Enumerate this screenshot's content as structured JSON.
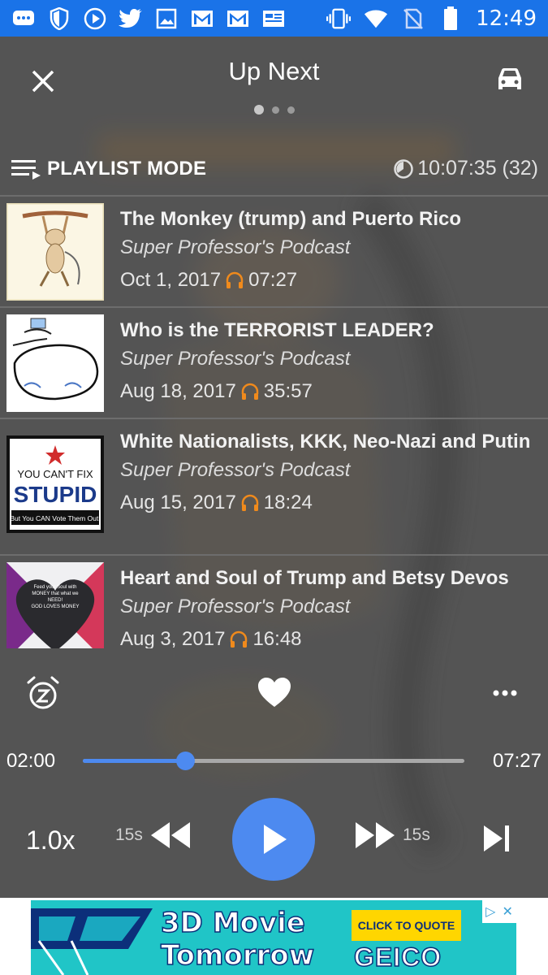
{
  "status_bar": {
    "time": "12:49",
    "icons": [
      "chat-icon",
      "shield-icon",
      "play-circle-icon",
      "twitter-icon",
      "image-icon",
      "gmail-icon",
      "gmail-icon",
      "news-icon",
      "vibrate-icon",
      "wifi-icon",
      "no-sim-icon",
      "battery-icon"
    ]
  },
  "header": {
    "title": "Up Next",
    "page_dots": 3,
    "active_dot": 0
  },
  "mode_row": {
    "mode_label": "PLAYLIST MODE",
    "total_duration": "10:07:35 (32)"
  },
  "episodes": [
    {
      "title": "The Monkey (trump) and Puerto Rico",
      "show": "Super Professor's Podcast",
      "date": "Oct 1, 2017",
      "duration": "07:27"
    },
    {
      "title": "Who is the TERRORIST LEADER?",
      "show": "Super Professor's Podcast",
      "date": "Aug 18, 2017",
      "duration": "35:57"
    },
    {
      "title": "White Nationalists, KKK, Neo-Nazi and Putin",
      "show": "Super Professor's Podcast",
      "date": "Aug 15, 2017",
      "duration": "18:24",
      "thumb_text": {
        "line1": "YOU CAN'T FIX",
        "line2": "STUPID",
        "line3": "But You CAN Vote Them Out!"
      }
    },
    {
      "title": "Heart and Soul of Trump and Betsy Devos",
      "show": "Super Professor's Podcast",
      "date": "Aug 3, 2017",
      "duration": "16:48",
      "thumb_text": {
        "line1": "Feed your Soul with",
        "line2": "MONEY that what we",
        "line3": "NEED!",
        "line4": "GOD LOVES MONEY"
      }
    }
  ],
  "player": {
    "current_time": "02:00",
    "total_time": "07:27",
    "progress": 0.268,
    "speed": "1.0x",
    "rewind_label": "15s",
    "forward_label": "15s"
  },
  "ad": {
    "headline_line1": "3D Movie",
    "headline_line2": "Tomorrow",
    "cta": "CLICK TO QUOTE",
    "brand": "GEICO"
  },
  "colors": {
    "status_bar": "#1a73e8",
    "accent": "#4d8af0",
    "headphone": "#f08a1c",
    "ad_bg": "#20c5c7"
  }
}
